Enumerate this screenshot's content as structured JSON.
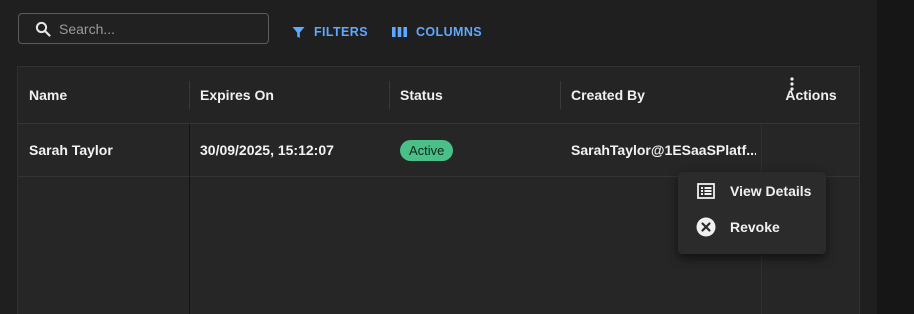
{
  "toolbar": {
    "search_placeholder": "Search...",
    "filters_label": "FILTERS",
    "columns_label": "COLUMNS",
    "accent_color": "#5ea8ff"
  },
  "grid": {
    "columns": [
      "Name",
      "Expires On",
      "Status",
      "Created By",
      "Actions"
    ],
    "rows": [
      {
        "name": "Sarah Taylor",
        "expires_on": "30/09/2025, 15:12:07",
        "status": "Active",
        "created_by": "SarahTaylor@1ESaaSPlatf..."
      }
    ]
  },
  "status_colors": {
    "Active": "#4ac088"
  },
  "row_menu": {
    "items": [
      {
        "label": "View Details",
        "icon": "list-details-icon"
      },
      {
        "label": "Revoke",
        "icon": "close-circle-icon"
      }
    ]
  }
}
